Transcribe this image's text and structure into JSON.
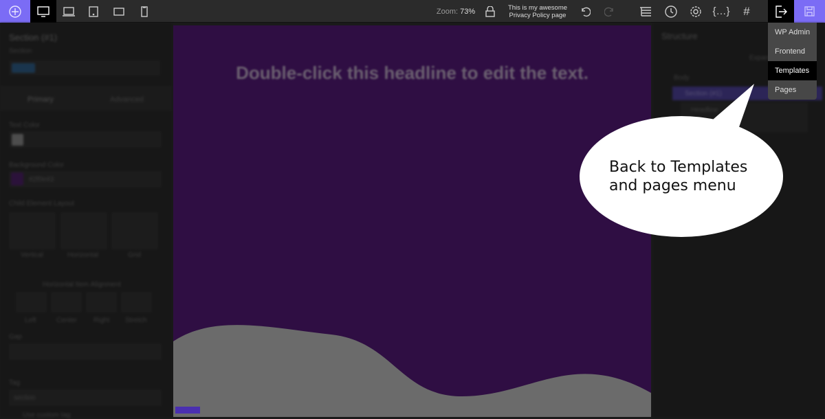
{
  "toolbar": {
    "zoom_label": "Zoom:",
    "zoom_value": "73%",
    "page_title_line1": "This is my awesome",
    "page_title_line2": "Privacy Policy page",
    "accent": "#7b6cf5"
  },
  "exit_menu": {
    "items": [
      "WP Admin",
      "Frontend",
      "Templates",
      "Pages"
    ],
    "active": "Templates"
  },
  "left_panel": {
    "title": "Section (#1)",
    "subtitle": "Section",
    "tab_primary": "Primary",
    "tab_advanced": "Advanced",
    "text_color_label": "Text Color",
    "bg_color_label": "Background Color",
    "bg_color_value": "#2f0e43",
    "layout_label": "Child Element Layout",
    "layouts": [
      "Vertical",
      "Horizontal",
      "Grid"
    ],
    "align_label": "Horizontal Item Alignment",
    "aligns": [
      "Left",
      "Center",
      "Right",
      "Stretch"
    ],
    "gap_label": "Gap",
    "tag_label": "Tag",
    "tag_value": "section",
    "custom_tag_label": "Use custom tag"
  },
  "canvas": {
    "headline": "Double-click this headline to edit the text."
  },
  "right_panel": {
    "title": "Structure",
    "expand": "Expand all",
    "tree": [
      "Body",
      "Section (#1)",
      "Headline"
    ]
  },
  "callout": {
    "line1": "Back to Templates",
    "line2": "and pages menu"
  }
}
